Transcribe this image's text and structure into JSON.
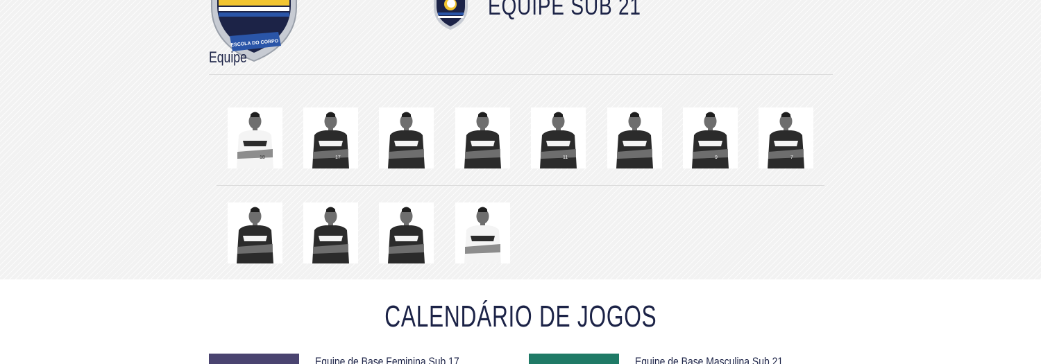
{
  "team": {
    "title": "EQUIPE SUB 21",
    "label": "Equipe",
    "crest_text": "ESCOLA DO CORPO",
    "players": [
      {
        "shirt": "18",
        "kit": "white"
      },
      {
        "shirt": "17",
        "kit": "black"
      },
      {
        "shirt": "",
        "kit": "black"
      },
      {
        "shirt": "",
        "kit": "black"
      },
      {
        "shirt": "11",
        "kit": "black"
      },
      {
        "shirt": "",
        "kit": "black"
      },
      {
        "shirt": "9",
        "kit": "black"
      },
      {
        "shirt": "7",
        "kit": "black"
      },
      {
        "shirt": "",
        "kit": "black"
      },
      {
        "shirt": "",
        "kit": "black"
      },
      {
        "shirt": "",
        "kit": "black"
      },
      {
        "shirt": "",
        "kit": "white"
      }
    ]
  },
  "calendar": {
    "title": "CALENDÁRIO DE JOGOS",
    "games": [
      {
        "label": "Equipe de Base Feminina Sub 17"
      },
      {
        "label": "Equipe de Base Masculina Sub 21"
      }
    ]
  },
  "colors": {
    "navy": "#1c2347",
    "crest_blue": "#2a55a8",
    "crest_yellow": "#f2c530",
    "thumb_purple": "#4a4470",
    "thumb_green": "#1f7a66"
  }
}
